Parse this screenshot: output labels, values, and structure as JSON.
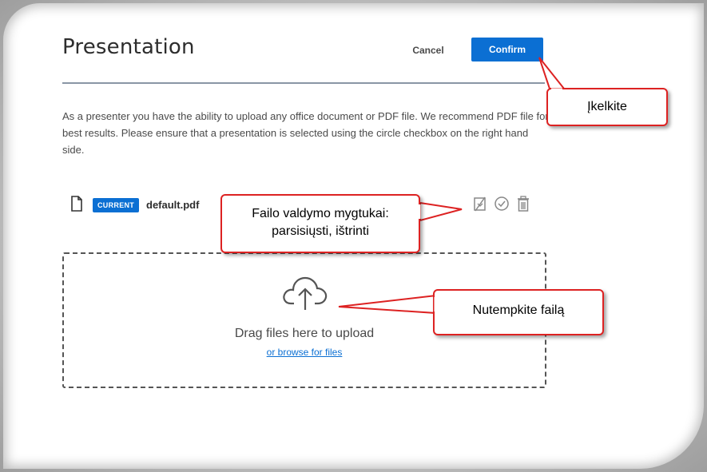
{
  "dialog": {
    "title": "Presentation",
    "cancel_label": "Cancel",
    "confirm_label": "Confirm",
    "instructions": "As a presenter you have the ability to upload any office document or PDF file. We recommend PDF file for best results. Please ensure that a presentation is selected using the circle checkbox on the right hand side."
  },
  "file": {
    "badge": "CURRENT",
    "name": "default.pdf",
    "actions": [
      "download-icon",
      "set-current-icon",
      "delete-icon"
    ]
  },
  "dropzone": {
    "icon": "cloud-upload-icon",
    "drag_text": "Drag files here to upload",
    "browse_link": "or browse for files"
  },
  "callouts": {
    "upload": "Įkelkite",
    "file_controls_line1": "Failo valdymo mygtukai:",
    "file_controls_line2": "parsisiųsti, ištrinti",
    "drop": "Nutempkite failą"
  },
  "colors": {
    "accent": "#0b6fd3",
    "callout_border": "#dd2222"
  }
}
